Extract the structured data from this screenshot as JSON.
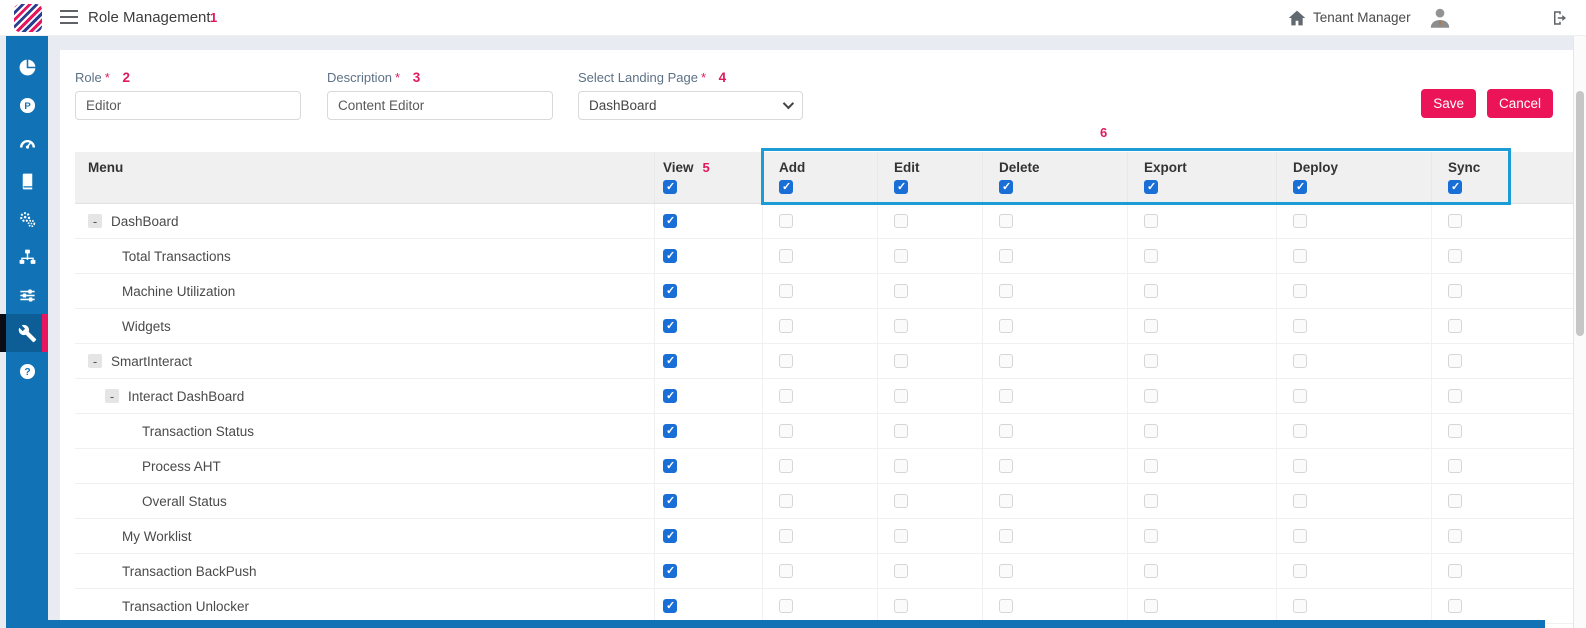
{
  "topbar": {
    "title": "Role Management",
    "annotation": "1",
    "tenant_label": "Tenant Manager"
  },
  "sidebar": {
    "items": [
      {
        "icon": "pie-chart-icon",
        "active": false
      },
      {
        "icon": "p-badge-icon",
        "active": false
      },
      {
        "icon": "gauge-icon",
        "active": false
      },
      {
        "icon": "book-icon",
        "active": false
      },
      {
        "icon": "gears-icon",
        "active": false
      },
      {
        "icon": "sitemap-icon",
        "active": false
      },
      {
        "icon": "sliders-icon",
        "active": false
      },
      {
        "icon": "wrench-icon",
        "active": true
      },
      {
        "icon": "help-icon",
        "active": false
      }
    ]
  },
  "form": {
    "fields": [
      {
        "label": "Role",
        "required": "*",
        "annotation": "2",
        "value": "Editor",
        "control": "input"
      },
      {
        "label": "Description",
        "required": "*",
        "annotation": "3",
        "value": "Content Editor",
        "control": "input"
      },
      {
        "label": "Select Landing Page",
        "required": "*",
        "annotation": "4",
        "value": "DashBoard",
        "control": "select"
      }
    ],
    "save_label": "Save",
    "cancel_label": "Cancel"
  },
  "table": {
    "menu_header": "Menu",
    "view_header": {
      "label": "View",
      "annotation": "5",
      "checked": true
    },
    "group_annotation": "6",
    "permission_headers": [
      {
        "label": "Add",
        "checked": true
      },
      {
        "label": "Edit",
        "checked": true
      },
      {
        "label": "Delete",
        "checked": true
      },
      {
        "label": "Export",
        "checked": true
      },
      {
        "label": "Deploy",
        "checked": true
      },
      {
        "label": "Sync",
        "checked": true
      }
    ],
    "rows": [
      {
        "label": "DashBoard",
        "level": 0,
        "expandable": true,
        "toggle": "-",
        "view": true,
        "perms": [
          false,
          false,
          false,
          false,
          false,
          false
        ]
      },
      {
        "label": "Total Transactions",
        "level": 1,
        "expandable": false,
        "view": true,
        "perms": [
          false,
          false,
          false,
          false,
          false,
          false
        ]
      },
      {
        "label": "Machine Utilization",
        "level": 1,
        "expandable": false,
        "view": true,
        "perms": [
          false,
          false,
          false,
          false,
          false,
          false
        ]
      },
      {
        "label": "Widgets",
        "level": 1,
        "expandable": false,
        "view": true,
        "perms": [
          false,
          false,
          false,
          false,
          false,
          false
        ]
      },
      {
        "label": "SmartInteract",
        "level": 0,
        "expandable": true,
        "toggle": "-",
        "view": true,
        "perms": [
          false,
          false,
          false,
          false,
          false,
          false
        ]
      },
      {
        "label": "Interact DashBoard",
        "level": 1,
        "expandable": true,
        "toggle": "-",
        "view": true,
        "perms": [
          false,
          false,
          false,
          false,
          false,
          false
        ]
      },
      {
        "label": "Transaction Status",
        "level": 2,
        "expandable": false,
        "view": true,
        "perms": [
          false,
          false,
          false,
          false,
          false,
          false
        ]
      },
      {
        "label": "Process AHT",
        "level": 2,
        "expandable": false,
        "view": true,
        "perms": [
          false,
          false,
          false,
          false,
          false,
          false
        ]
      },
      {
        "label": "Overall Status",
        "level": 2,
        "expandable": false,
        "view": true,
        "perms": [
          false,
          false,
          false,
          false,
          false,
          false
        ]
      },
      {
        "label": "My Worklist",
        "level": 1,
        "expandable": false,
        "view": true,
        "perms": [
          false,
          false,
          false,
          false,
          false,
          false
        ]
      },
      {
        "label": "Transaction BackPush",
        "level": 1,
        "expandable": false,
        "view": true,
        "perms": [
          false,
          false,
          false,
          false,
          false,
          false
        ]
      },
      {
        "label": "Transaction Unlocker",
        "level": 1,
        "expandable": false,
        "view": true,
        "perms": [
          false,
          false,
          false,
          false,
          false,
          false
        ]
      }
    ]
  },
  "colors": {
    "accent": "#ec1459",
    "sidebar_blue": "#1173b5",
    "checkbox_blue": "#1a6fd6",
    "highlight_border": "#1b9cd4",
    "annotation_red": "#e0195e"
  }
}
